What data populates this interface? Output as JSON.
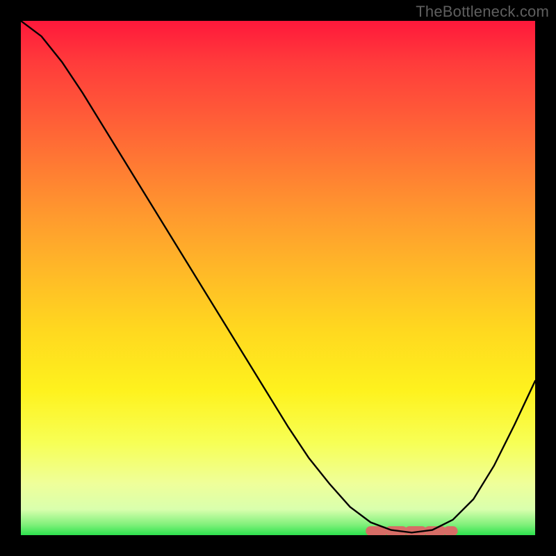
{
  "attribution": "TheBottleneck.com",
  "colors": {
    "page_bg": "#000000",
    "attribution_text": "#5f5f5f",
    "curve_stroke": "#000000",
    "bead_stroke": "#d76d66",
    "gradient_top": "#ff183b",
    "gradient_bottom": "#2de24d"
  },
  "chart_data": {
    "type": "line",
    "title": "",
    "xlabel": "",
    "ylabel": "",
    "xlim": [
      0,
      100
    ],
    "ylim": [
      0,
      100
    ],
    "grid": false,
    "legend": null,
    "annotations": [],
    "series": [
      {
        "name": "bottleneck-curve",
        "x": [
          0,
          4,
          8,
          12,
          16,
          20,
          24,
          28,
          32,
          36,
          40,
          44,
          48,
          52,
          56,
          60,
          64,
          68,
          72,
          76,
          80,
          84,
          88,
          92,
          96,
          100
        ],
        "y": [
          100,
          97,
          92,
          86,
          79.5,
          73,
          66.5,
          60,
          53.5,
          47,
          40.5,
          34,
          27.5,
          21,
          15,
          10,
          5.5,
          2.5,
          1,
          0.5,
          1,
          3,
          7,
          13.5,
          21.5,
          30
        ]
      }
    ],
    "optimal_band": {
      "x_start": 68,
      "x_end": 84,
      "y": 0.8
    }
  }
}
